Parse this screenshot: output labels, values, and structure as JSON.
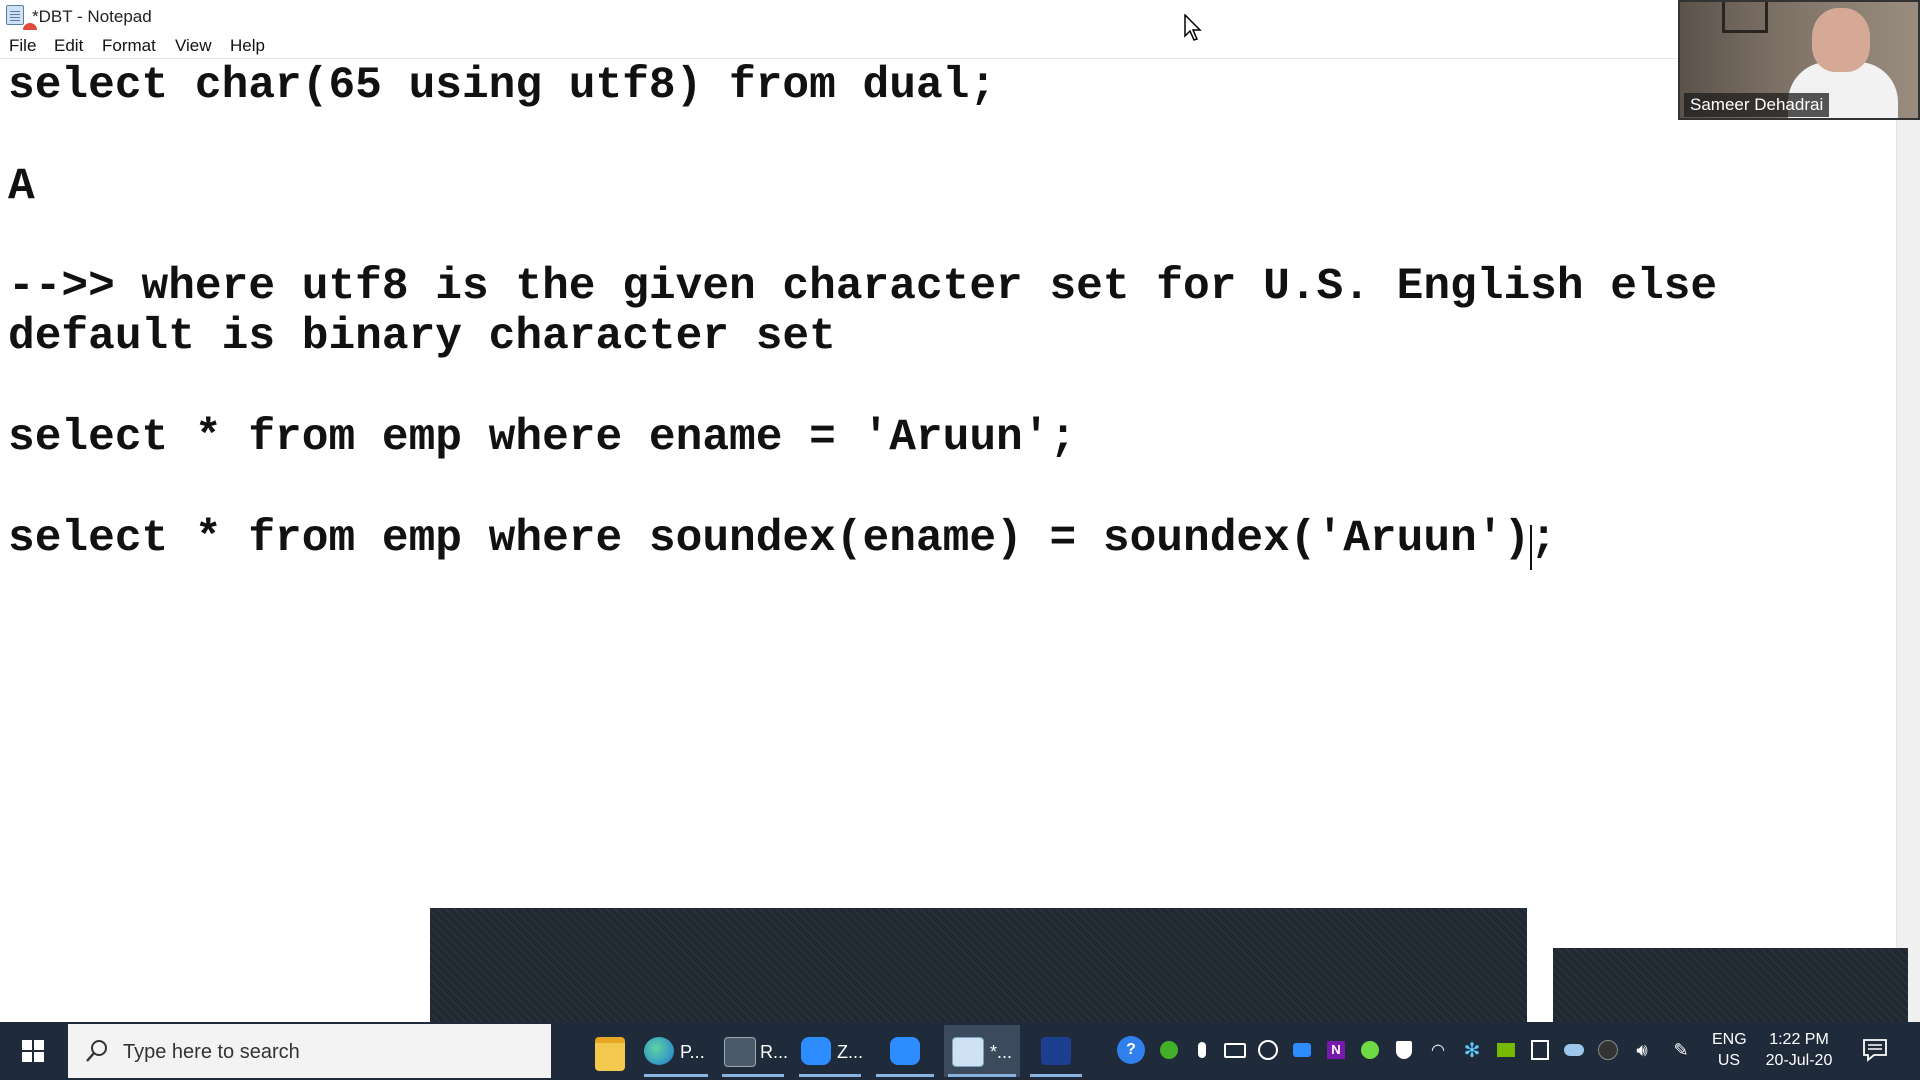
{
  "window": {
    "title": "*DBT - Notepad"
  },
  "menu": {
    "items": [
      "File",
      "Edit",
      "Format",
      "View",
      "Help"
    ]
  },
  "editor": {
    "lines": [
      "select char(65 using utf8) from dual;",
      "A",
      "-->> where utf8 is the given character set for U.S. English else",
      "default is binary character set",
      "select * from emp where ename = 'Aruun';",
      "select * from emp where soundex(ename) = soundex('Aruun');"
    ]
  },
  "video": {
    "participant_name": "Sameer Dehadrai"
  },
  "taskbar": {
    "search_placeholder": "Type here to search",
    "apps": [
      {
        "icon": "file-explorer-icon",
        "label": ""
      },
      {
        "icon": "edge-icon",
        "label": "P..."
      },
      {
        "icon": "sql-icon",
        "label": "R..."
      },
      {
        "icon": "zoom-icon",
        "label": "Z..."
      },
      {
        "icon": "zoom-meeting-icon",
        "label": ""
      },
      {
        "icon": "notepad-icon",
        "label": "*..."
      },
      {
        "icon": "stock-chart-icon",
        "label": ""
      }
    ],
    "language": "ENG",
    "region": "US",
    "time": "1:22 PM",
    "date": "20-Jul-20"
  },
  "colors": {
    "taskbar_bg": "#1f2b3a",
    "overlay_bg": "#202831",
    "text": "#111111"
  }
}
